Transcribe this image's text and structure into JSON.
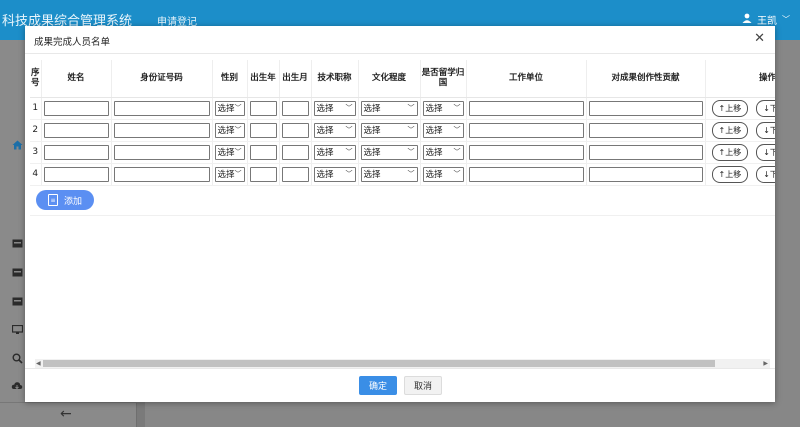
{
  "app": {
    "title": "科技成果综合管理系统",
    "tab": "申请登记",
    "user": "王凯",
    "user_chevron": "﹀",
    "collapse_arrow": "←"
  },
  "modal": {
    "title": "成果完成人员名单",
    "close": "✕"
  },
  "table": {
    "headers": {
      "seq": "序号",
      "name": "姓名",
      "id_no": "身份证号码",
      "gender": "性别",
      "birth_year": "出生年",
      "birth_month": "出生月",
      "title": "技术职称",
      "education": "文化程度",
      "returnee": "是否留学归国",
      "employer": "工作单位",
      "contribution": "对成果创作性贡献",
      "ops": "操作"
    },
    "select_placeholder": "选择",
    "rows": [
      {
        "num": "1"
      },
      {
        "num": "2"
      },
      {
        "num": "3"
      },
      {
        "num": "4"
      }
    ],
    "move_up": "↑上移",
    "move_down": "↓下移",
    "add": "添加"
  },
  "footer": {
    "ok": "确定",
    "cancel": "取消"
  },
  "colors": {
    "header_bg": "#1c8ec9",
    "primary": "#3a8ee6",
    "add_button": "#5b8ff2"
  }
}
